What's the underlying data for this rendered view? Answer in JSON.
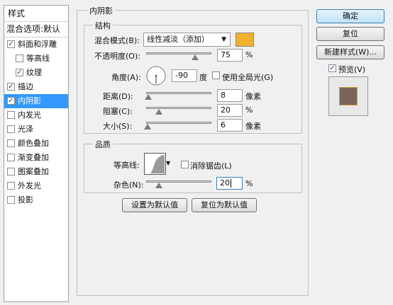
{
  "sidebar": {
    "title": "样式",
    "blend_options": "混合选项:默认",
    "items": [
      {
        "label": "斜面和浮雕",
        "checked": true
      },
      {
        "label": "等高线",
        "checked": false
      },
      {
        "label": "纹理",
        "checked": true
      },
      {
        "label": "描边",
        "checked": true
      },
      {
        "label": "内阴影",
        "checked": true
      },
      {
        "label": "内发光",
        "checked": false
      },
      {
        "label": "光泽",
        "checked": false
      },
      {
        "label": "颜色叠加",
        "checked": false
      },
      {
        "label": "渐变叠加",
        "checked": false
      },
      {
        "label": "图案叠加",
        "checked": false
      },
      {
        "label": "外发光",
        "checked": false
      },
      {
        "label": "投影",
        "checked": false
      }
    ],
    "check_glyph": "✓"
  },
  "inner_shadow": {
    "title": "内阴影",
    "structure": {
      "title": "结构",
      "blend_mode_label": "混合模式(B):",
      "blend_mode_value": "线性减淡（添加）",
      "color": "#f0b030",
      "opacity_label": "不透明度(O):",
      "opacity_value": "75",
      "opacity_fraction": 0.75,
      "angle_label": "角度(A):",
      "angle_value": "-90",
      "angle_unit": "度",
      "global_light_label": "使用全局光(G)",
      "global_light_checked": false,
      "distance_label": "距离(D):",
      "distance_value": "8",
      "distance_unit": "像素",
      "distance_fraction": 0.03,
      "choke_label": "阻塞(C):",
      "choke_value": "20",
      "choke_fraction": 0.2,
      "size_label": "大小(S):",
      "size_value": "6",
      "size_unit": "像素",
      "size_fraction": 0.02,
      "percent": "%"
    },
    "quality": {
      "title": "品质",
      "contour_label": "等高线:",
      "antialias_label": "消除锯齿(L)",
      "antialias_checked": false,
      "noise_label": "杂色(N):",
      "noise_value": "20",
      "noise_fraction": 0.2,
      "percent": "%"
    },
    "set_default_button": "设置为默认值",
    "reset_default_button": "复位为默认值"
  },
  "right": {
    "ok_button": "确定",
    "reset_button": "复位",
    "new_style_button": "新建样式(W)...",
    "preview_label": "预览(V)",
    "preview_checked": true,
    "preview_swatch_color": "#7a6458"
  }
}
